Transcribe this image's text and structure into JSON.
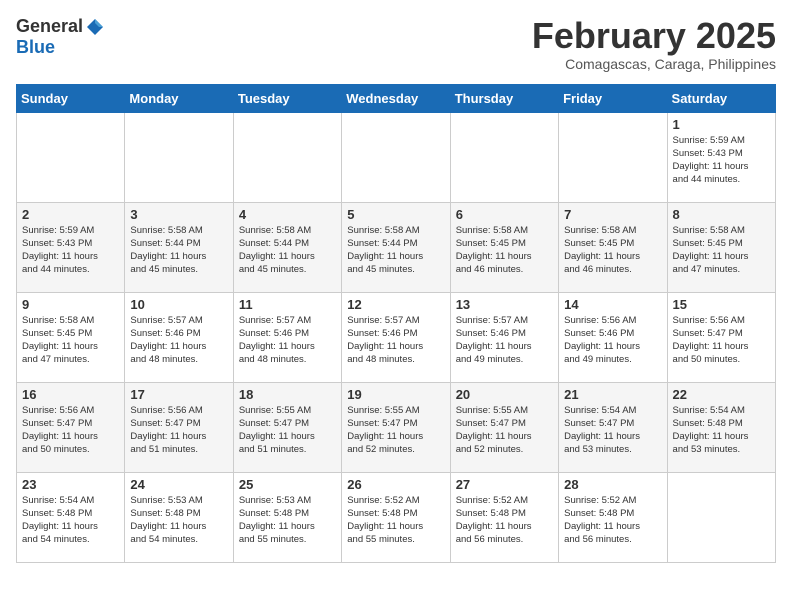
{
  "header": {
    "logo_general": "General",
    "logo_blue": "Blue",
    "month_title": "February 2025",
    "location": "Comagascas, Caraga, Philippines"
  },
  "days_of_week": [
    "Sunday",
    "Monday",
    "Tuesday",
    "Wednesday",
    "Thursday",
    "Friday",
    "Saturday"
  ],
  "weeks": [
    [
      {
        "day": "",
        "info": ""
      },
      {
        "day": "",
        "info": ""
      },
      {
        "day": "",
        "info": ""
      },
      {
        "day": "",
        "info": ""
      },
      {
        "day": "",
        "info": ""
      },
      {
        "day": "",
        "info": ""
      },
      {
        "day": "1",
        "info": "Sunrise: 5:59 AM\nSunset: 5:43 PM\nDaylight: 11 hours\nand 44 minutes."
      }
    ],
    [
      {
        "day": "2",
        "info": "Sunrise: 5:59 AM\nSunset: 5:43 PM\nDaylight: 11 hours\nand 44 minutes."
      },
      {
        "day": "3",
        "info": "Sunrise: 5:58 AM\nSunset: 5:44 PM\nDaylight: 11 hours\nand 45 minutes."
      },
      {
        "day": "4",
        "info": "Sunrise: 5:58 AM\nSunset: 5:44 PM\nDaylight: 11 hours\nand 45 minutes."
      },
      {
        "day": "5",
        "info": "Sunrise: 5:58 AM\nSunset: 5:44 PM\nDaylight: 11 hours\nand 45 minutes."
      },
      {
        "day": "6",
        "info": "Sunrise: 5:58 AM\nSunset: 5:45 PM\nDaylight: 11 hours\nand 46 minutes."
      },
      {
        "day": "7",
        "info": "Sunrise: 5:58 AM\nSunset: 5:45 PM\nDaylight: 11 hours\nand 46 minutes."
      },
      {
        "day": "8",
        "info": "Sunrise: 5:58 AM\nSunset: 5:45 PM\nDaylight: 11 hours\nand 47 minutes."
      }
    ],
    [
      {
        "day": "9",
        "info": "Sunrise: 5:58 AM\nSunset: 5:45 PM\nDaylight: 11 hours\nand 47 minutes."
      },
      {
        "day": "10",
        "info": "Sunrise: 5:57 AM\nSunset: 5:46 PM\nDaylight: 11 hours\nand 48 minutes."
      },
      {
        "day": "11",
        "info": "Sunrise: 5:57 AM\nSunset: 5:46 PM\nDaylight: 11 hours\nand 48 minutes."
      },
      {
        "day": "12",
        "info": "Sunrise: 5:57 AM\nSunset: 5:46 PM\nDaylight: 11 hours\nand 48 minutes."
      },
      {
        "day": "13",
        "info": "Sunrise: 5:57 AM\nSunset: 5:46 PM\nDaylight: 11 hours\nand 49 minutes."
      },
      {
        "day": "14",
        "info": "Sunrise: 5:56 AM\nSunset: 5:46 PM\nDaylight: 11 hours\nand 49 minutes."
      },
      {
        "day": "15",
        "info": "Sunrise: 5:56 AM\nSunset: 5:47 PM\nDaylight: 11 hours\nand 50 minutes."
      }
    ],
    [
      {
        "day": "16",
        "info": "Sunrise: 5:56 AM\nSunset: 5:47 PM\nDaylight: 11 hours\nand 50 minutes."
      },
      {
        "day": "17",
        "info": "Sunrise: 5:56 AM\nSunset: 5:47 PM\nDaylight: 11 hours\nand 51 minutes."
      },
      {
        "day": "18",
        "info": "Sunrise: 5:55 AM\nSunset: 5:47 PM\nDaylight: 11 hours\nand 51 minutes."
      },
      {
        "day": "19",
        "info": "Sunrise: 5:55 AM\nSunset: 5:47 PM\nDaylight: 11 hours\nand 52 minutes."
      },
      {
        "day": "20",
        "info": "Sunrise: 5:55 AM\nSunset: 5:47 PM\nDaylight: 11 hours\nand 52 minutes."
      },
      {
        "day": "21",
        "info": "Sunrise: 5:54 AM\nSunset: 5:47 PM\nDaylight: 11 hours\nand 53 minutes."
      },
      {
        "day": "22",
        "info": "Sunrise: 5:54 AM\nSunset: 5:48 PM\nDaylight: 11 hours\nand 53 minutes."
      }
    ],
    [
      {
        "day": "23",
        "info": "Sunrise: 5:54 AM\nSunset: 5:48 PM\nDaylight: 11 hours\nand 54 minutes."
      },
      {
        "day": "24",
        "info": "Sunrise: 5:53 AM\nSunset: 5:48 PM\nDaylight: 11 hours\nand 54 minutes."
      },
      {
        "day": "25",
        "info": "Sunrise: 5:53 AM\nSunset: 5:48 PM\nDaylight: 11 hours\nand 55 minutes."
      },
      {
        "day": "26",
        "info": "Sunrise: 5:52 AM\nSunset: 5:48 PM\nDaylight: 11 hours\nand 55 minutes."
      },
      {
        "day": "27",
        "info": "Sunrise: 5:52 AM\nSunset: 5:48 PM\nDaylight: 11 hours\nand 56 minutes."
      },
      {
        "day": "28",
        "info": "Sunrise: 5:52 AM\nSunset: 5:48 PM\nDaylight: 11 hours\nand 56 minutes."
      },
      {
        "day": "",
        "info": ""
      }
    ]
  ]
}
